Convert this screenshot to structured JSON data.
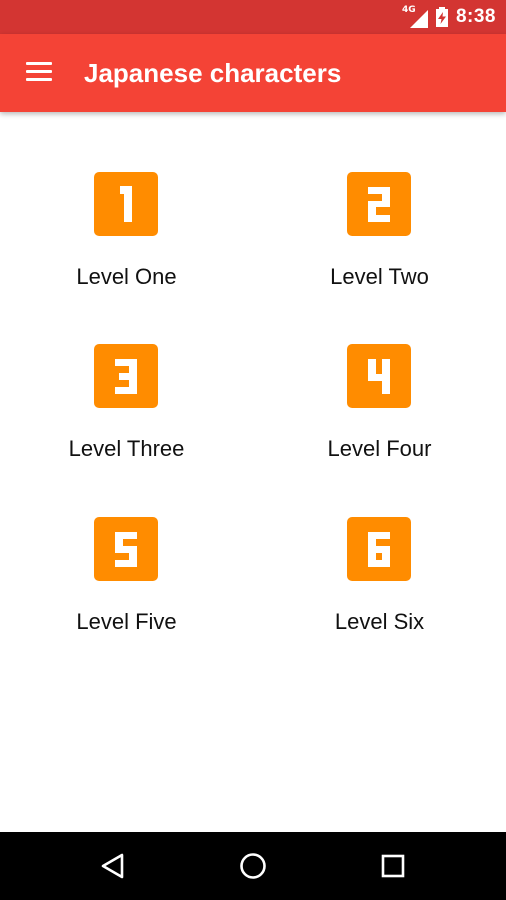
{
  "status_bar": {
    "network": "4G",
    "time": "8:38"
  },
  "app_bar": {
    "title": "Japanese characters",
    "menu_icon": "hamburger-menu-icon"
  },
  "colors": {
    "status_bar": "#d33532",
    "app_bar": "#f44336",
    "badge": "#ff8c00"
  },
  "levels": [
    {
      "number": "1",
      "label": "Level One"
    },
    {
      "number": "2",
      "label": "Level Two"
    },
    {
      "number": "3",
      "label": "Level Three"
    },
    {
      "number": "4",
      "label": "Level Four"
    },
    {
      "number": "5",
      "label": "Level Five"
    },
    {
      "number": "6",
      "label": "Level Six"
    }
  ],
  "nav_bar": {
    "buttons": [
      "back-icon",
      "home-icon",
      "recents-icon"
    ]
  }
}
